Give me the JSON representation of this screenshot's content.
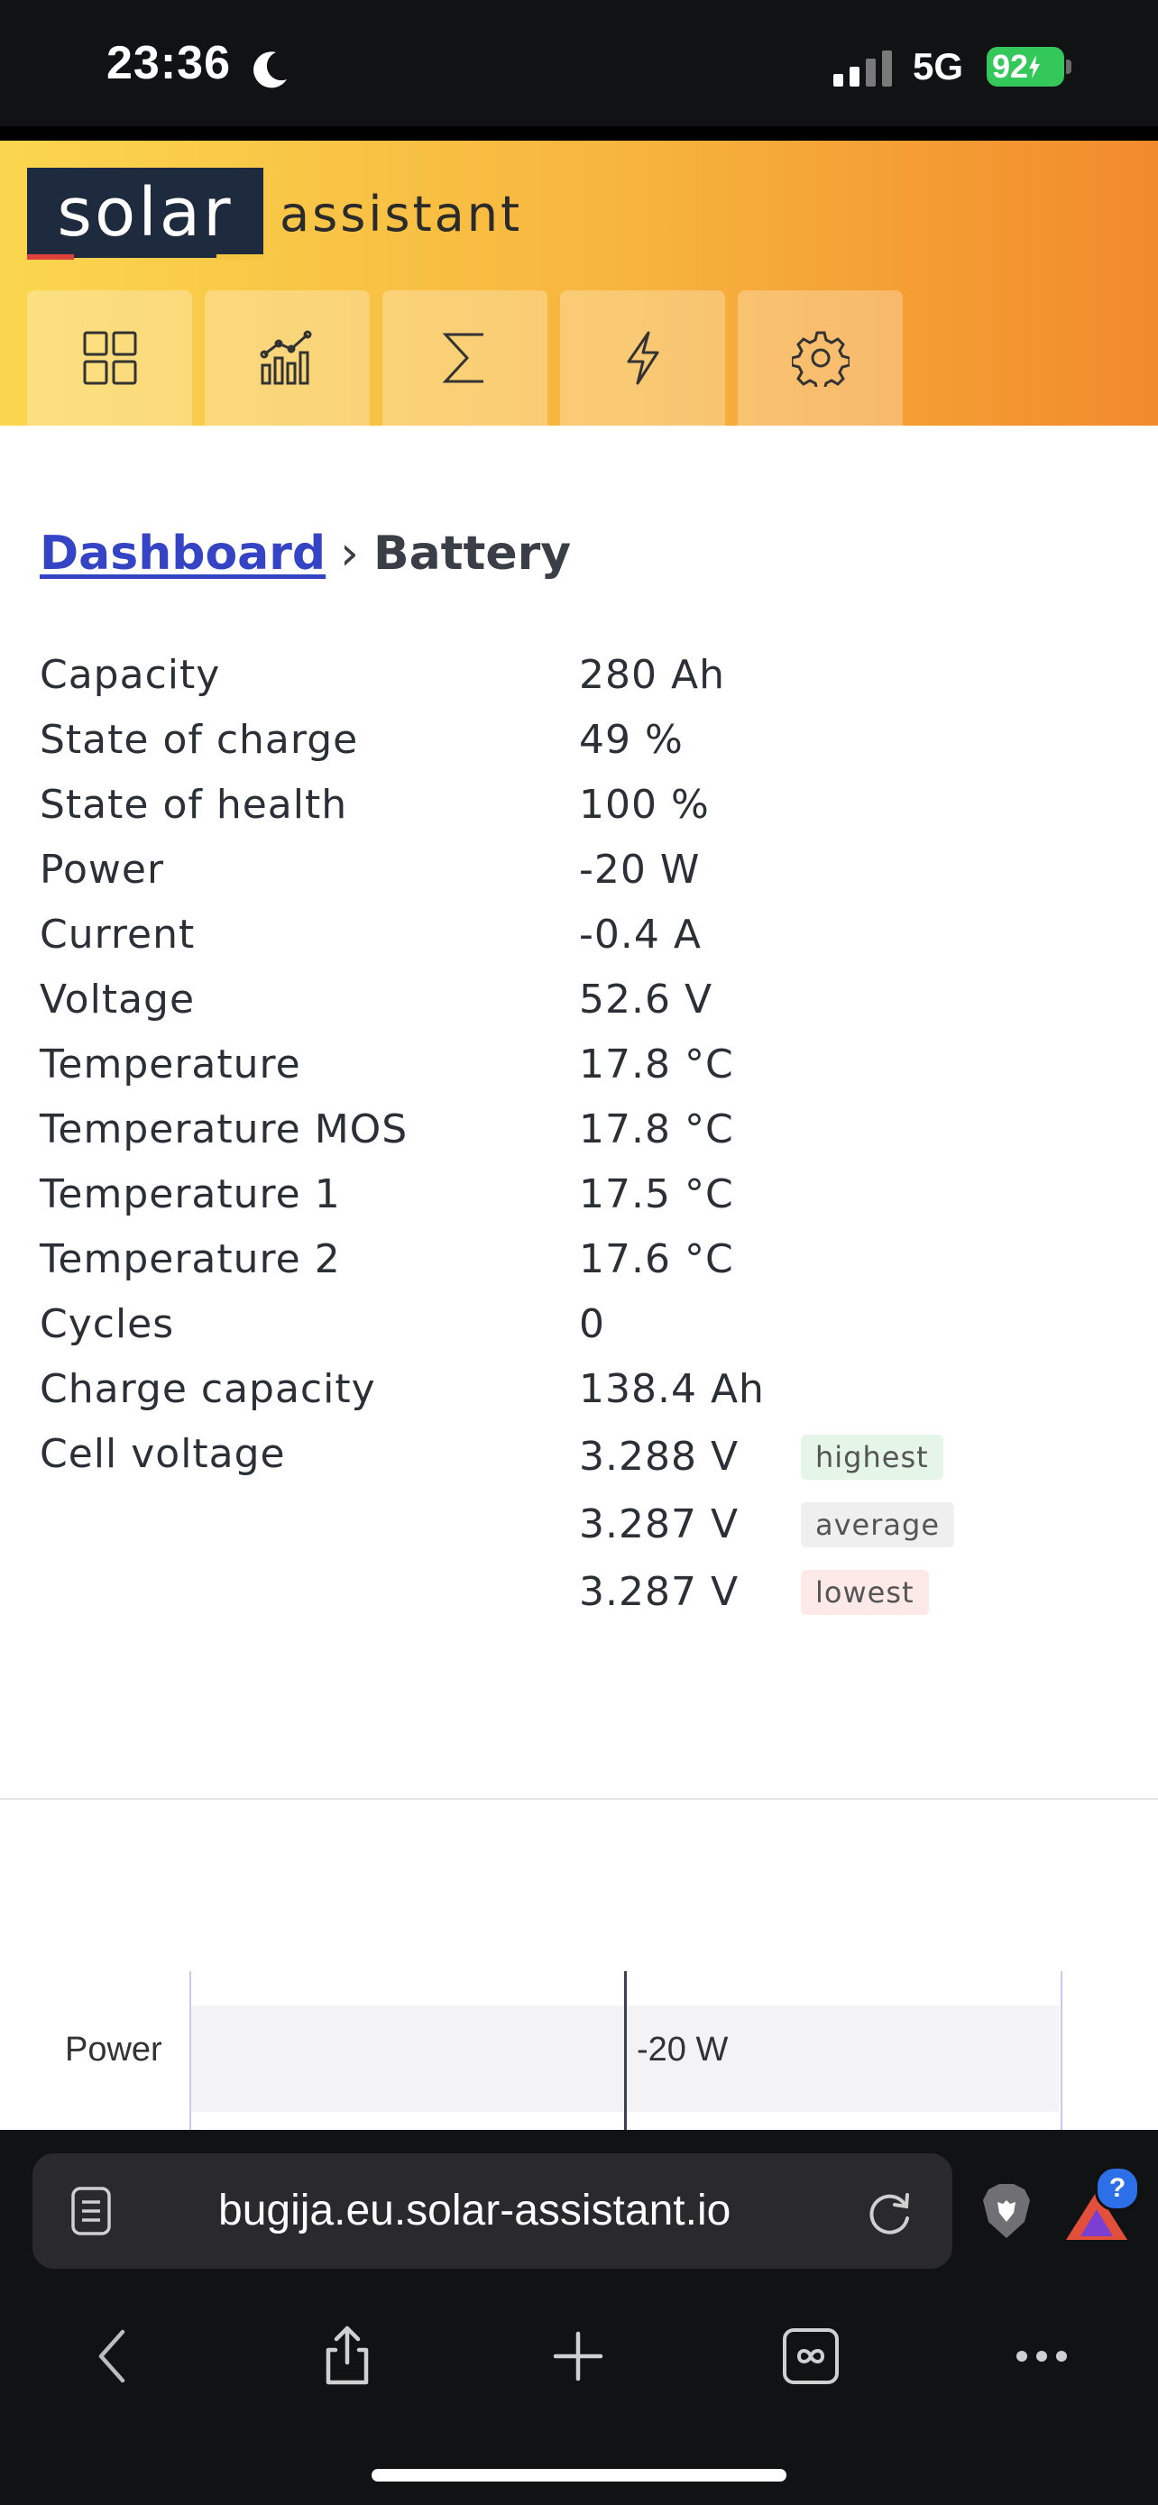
{
  "status_bar": {
    "time": "23:36",
    "network": "5G",
    "battery": "92"
  },
  "header": {
    "logo_text": "solar",
    "logo_suffix": "assistant",
    "nav": [
      {
        "icon": "dashboard-grid-icon"
      },
      {
        "icon": "charts-icon"
      },
      {
        "icon": "sigma-icon"
      },
      {
        "icon": "lightning-icon"
      },
      {
        "icon": "gear-icon"
      }
    ]
  },
  "breadcrumb": {
    "link": "Dashboard",
    "separator": "›",
    "current": "Battery"
  },
  "stats": [
    {
      "label": "Capacity",
      "value": "280 Ah"
    },
    {
      "label": "State of charge",
      "value": "49 %"
    },
    {
      "label": "State of health",
      "value": "100 %"
    },
    {
      "label": "Power",
      "value": "-20 W"
    },
    {
      "label": "Current",
      "value": "-0.4 A"
    },
    {
      "label": "Voltage",
      "value": "52.6 V"
    },
    {
      "label": "Temperature",
      "value": "17.8 °C"
    },
    {
      "label": "Temperature MOS",
      "value": "17.8 °C"
    },
    {
      "label": "Temperature 1",
      "value": "17.5 °C"
    },
    {
      "label": "Temperature 2",
      "value": "17.6 °C"
    },
    {
      "label": "Cycles",
      "value": "0"
    },
    {
      "label": "Charge capacity",
      "value": "138.4 Ah"
    },
    {
      "label": "Cell voltage",
      "value": ""
    }
  ],
  "cell_voltage": [
    {
      "value": "3.288 V",
      "tag": "highest"
    },
    {
      "value": "3.287 V",
      "tag": "average"
    },
    {
      "value": "3.287 V",
      "tag": "lowest"
    }
  ],
  "power_gauge": {
    "label": "Power",
    "value": "-20 W"
  },
  "browser": {
    "url": "bugija.eu.solar-assistant.io",
    "badge": "?"
  },
  "colors": {
    "header_gradient_start": "#fbd64f",
    "header_gradient_end": "#f18a2c",
    "logo_bg": "#1e2a3d",
    "link": "#3543c5",
    "battery_green": "#34c759"
  }
}
